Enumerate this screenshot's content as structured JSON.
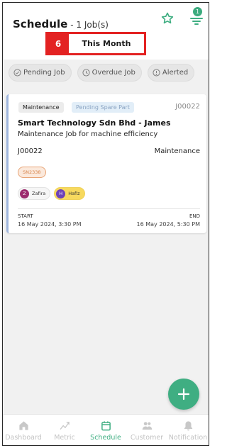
{
  "header": {
    "title": "Schedule",
    "subtitle": "- 1 Job(s)",
    "filter_badge": "1"
  },
  "period": {
    "number": "6",
    "label": "This Month"
  },
  "chips": [
    {
      "label": "Pending Job",
      "icon": "check-circle-icon"
    },
    {
      "label": "Overdue Job",
      "icon": "clock-icon"
    },
    {
      "label": "Alerted",
      "icon": "alert-circle-icon"
    }
  ],
  "job": {
    "category": "Maintenance",
    "status": "Pending Spare Part",
    "code_top": "J00022",
    "company": "Smart Technology Sdn Bhd - James",
    "description": "Maintenance Job for machine efficiency",
    "code": "J00022",
    "type": "Maintenance",
    "serial": "SN2338",
    "people": [
      {
        "initial": "Z",
        "name": "Zafira"
      },
      {
        "initial": "H",
        "name": "Hafiz"
      }
    ],
    "start_label": "START",
    "end_label": "END",
    "start": "16 May 2024, 3:30 PM",
    "end": "16 May 2024, 5:30 PM"
  },
  "nav": [
    {
      "label": "Dashboard",
      "icon": "home-icon",
      "active": false
    },
    {
      "label": "Metric",
      "icon": "chart-icon",
      "active": false
    },
    {
      "label": "Schedule",
      "icon": "calendar-icon",
      "active": true
    },
    {
      "label": "Customer",
      "icon": "people-icon",
      "active": false
    },
    {
      "label": "Notification",
      "icon": "bell-icon",
      "active": false
    }
  ],
  "colors": {
    "accent": "#3fae82",
    "highlight": "#e32222",
    "card_border": "#9fb6de"
  }
}
